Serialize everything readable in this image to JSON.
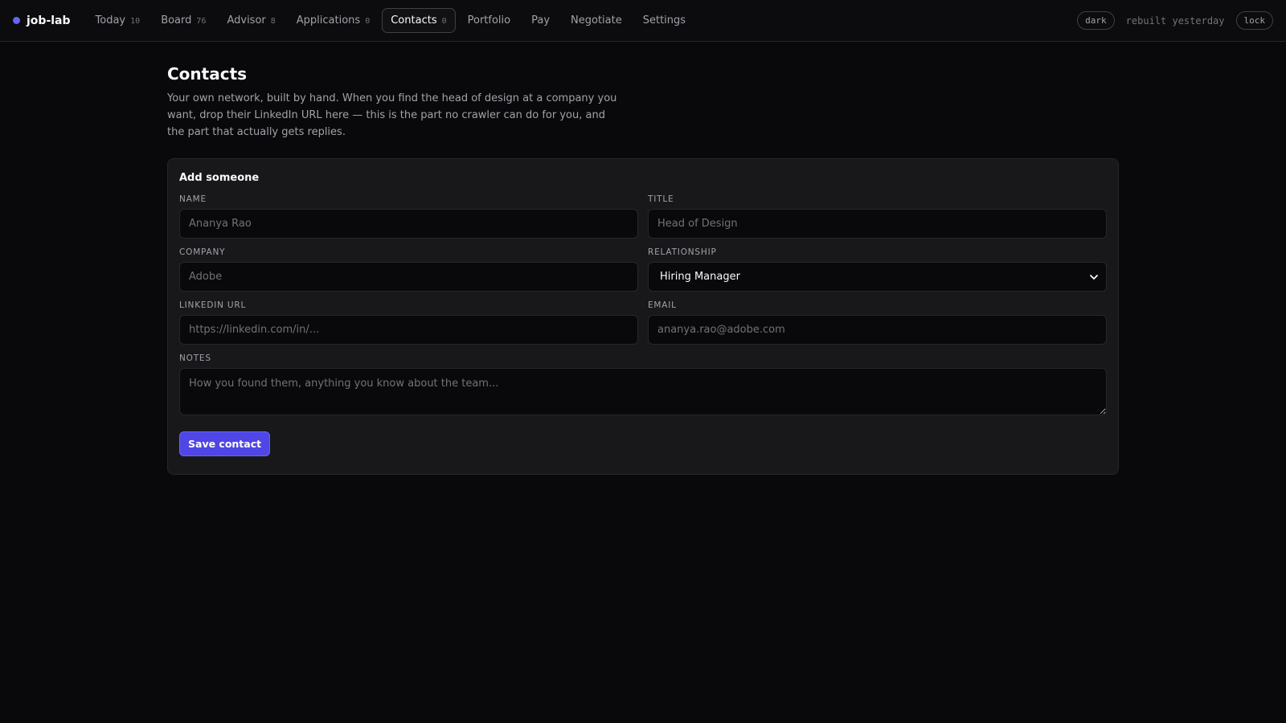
{
  "colors": {
    "accent": "#6366f1",
    "background": "#09090b",
    "card": "#18181b"
  },
  "app": {
    "name": "job-lab",
    "logo_icon": "dot-icon"
  },
  "nav": [
    {
      "label": "Today",
      "count": "10"
    },
    {
      "label": "Board",
      "count": "76"
    },
    {
      "label": "Advisor",
      "count": "8"
    },
    {
      "label": "Applications",
      "count": "0"
    },
    {
      "label": "Contacts",
      "count": "0",
      "active": true
    },
    {
      "label": "Portfolio",
      "count": ""
    },
    {
      "label": "Pay",
      "count": ""
    },
    {
      "label": "Negotiate",
      "count": ""
    },
    {
      "label": "Settings",
      "count": ""
    }
  ],
  "topbar": {
    "theme_toggle": "dark",
    "status": "rebuilt yesterday",
    "lock_label": "lock"
  },
  "page": {
    "title": "Contacts",
    "intro": "Your own network, built by hand. When you find the head of design at a company you want, drop their LinkedIn URL here — this is the part no crawler can do for you, and the part that actually gets replies."
  },
  "form": {
    "title": "Add someone",
    "name": {
      "label": "Name",
      "placeholder": "Ananya Rao"
    },
    "title_field": {
      "label": "Title",
      "placeholder": "Head of Design"
    },
    "company": {
      "label": "Company",
      "placeholder": "Adobe"
    },
    "relationship": {
      "label": "Relationship",
      "value": "Hiring Manager",
      "icon": "chevron-down-icon"
    },
    "linkedin": {
      "label": "LinkedIn URL",
      "placeholder": "https://linkedin.com/in/..."
    },
    "email": {
      "label": "Email",
      "placeholder": "ananya.rao@adobe.com"
    },
    "notes": {
      "label": "Notes",
      "placeholder": "How you found them, anything you know about the team..."
    },
    "save_label": "Save contact"
  }
}
